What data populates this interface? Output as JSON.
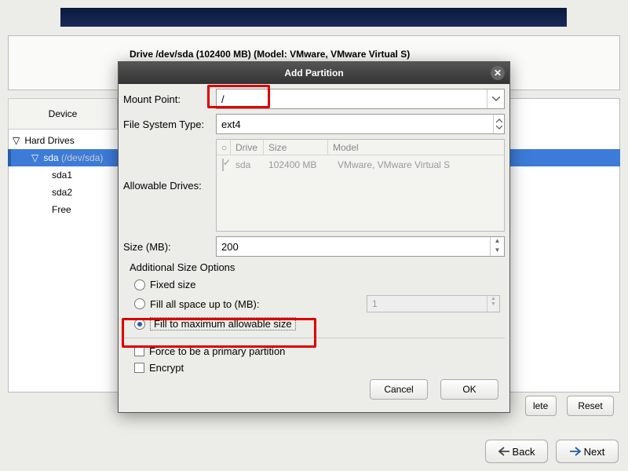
{
  "background": {
    "drive_label": "Drive /dev/sda (102400 MB) (Model: VMware, VMware Virtual S)",
    "device_header": "Device",
    "tree": {
      "hard_drives": "Hard Drives",
      "sda": "sda",
      "sda_dev": "(/dev/sda)",
      "children": [
        "sda1",
        "sda2",
        "Free"
      ]
    },
    "btn_delete_tail": "lete",
    "btn_reset": "Reset",
    "btn_back": "Back",
    "btn_next": "Next"
  },
  "dialog": {
    "title": "Add Partition",
    "labels": {
      "mount_point": "Mount Point:",
      "fs_type": "File System Type:",
      "allowable_drives": "Allowable Drives:",
      "size_mb": "Size (MB):",
      "additional": "Additional Size Options",
      "fixed": "Fixed size",
      "fill_up_to": "Fill all space up to (MB):",
      "fill_max": "Fill to maximum allowable size",
      "force_primary": "Force to be a primary partition",
      "encrypt": "Encrypt"
    },
    "values": {
      "mount_point": "/",
      "fs_type": "ext4",
      "size_mb": "200",
      "fill_up_to": "1"
    },
    "drives": {
      "headers": {
        "drive": "Drive",
        "size": "Size",
        "model": "Model"
      },
      "row": {
        "checked": true,
        "name": "sda",
        "size": "102400 MB",
        "model": "VMware, VMware Virtual S"
      }
    },
    "radio_selected": "fill_max",
    "checks": {
      "force_primary": false,
      "encrypt": false
    },
    "buttons": {
      "cancel": "Cancel",
      "ok": "OK"
    }
  }
}
